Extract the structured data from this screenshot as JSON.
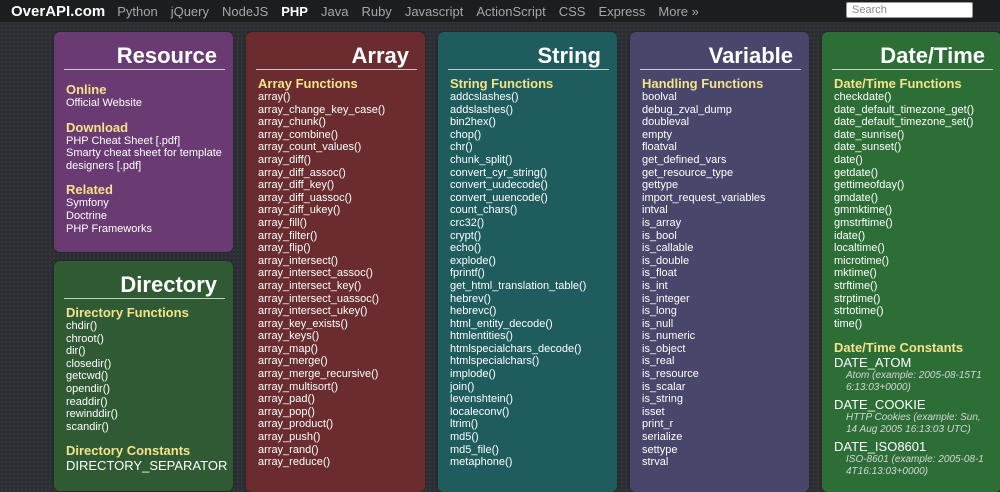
{
  "topbar": {
    "logo": "OverAPI.com",
    "nav": [
      "Python",
      "jQuery",
      "NodeJS",
      "PHP",
      "Java",
      "Ruby",
      "Javascript",
      "ActionScript",
      "CSS",
      "Express",
      "More »"
    ],
    "active": "PHP",
    "search_placeholder": "Search"
  },
  "colors": {
    "resource": "#6a3a73",
    "array": "#6a2c2e",
    "string": "#1f5c5e",
    "variable": "#48466a",
    "datetime": "#2d6e37",
    "directory": "#2f5a34",
    "section_heading": "#f4e38a"
  },
  "resource": {
    "title": "Resource",
    "sections": [
      {
        "heading": "Online",
        "items": [
          "Official Website"
        ]
      },
      {
        "heading": "Download",
        "items": [
          "PHP Cheat Sheet [.pdf]",
          "Smarty cheat sheet for template",
          "designers [.pdf]"
        ]
      },
      {
        "heading": "Related",
        "items": [
          "Symfony",
          "Doctrine",
          "PHP Frameworks"
        ]
      }
    ]
  },
  "directory": {
    "title": "Directory",
    "sections": [
      {
        "heading": "Directory Functions",
        "items": [
          "chdir()",
          "chroot()",
          "dir()",
          "closedir()",
          "getcwd()",
          "opendir()",
          "readdir()",
          "rewinddir()",
          "scandir()"
        ]
      },
      {
        "heading": "Directory Constants",
        "constants": [
          "DIRECTORY_SEPARATOR"
        ]
      }
    ]
  },
  "array": {
    "title": "Array",
    "heading": "Array Functions",
    "items": [
      "array()",
      "array_change_key_case()",
      "array_chunk()",
      "array_combine()",
      "array_count_values()",
      "array_diff()",
      "array_diff_assoc()",
      "array_diff_key()",
      "array_diff_uassoc()",
      "array_diff_ukey()",
      "array_fill()",
      "array_filter()",
      "array_flip()",
      "array_intersect()",
      "array_intersect_assoc()",
      "array_intersect_key()",
      "array_intersect_uassoc()",
      "array_intersect_ukey()",
      "array_key_exists()",
      "array_keys()",
      "array_map()",
      "array_merge()",
      "array_merge_recursive()",
      "array_multisort()",
      "array_pad()",
      "array_pop()",
      "array_product()",
      "array_push()",
      "array_rand()",
      "array_reduce()"
    ]
  },
  "string": {
    "title": "String",
    "heading": "String Functions",
    "items": [
      "addcslashes()",
      "addslashes()",
      "bin2hex()",
      "chop()",
      "chr()",
      "chunk_split()",
      "convert_cyr_string()",
      "convert_uudecode()",
      "convert_uuencode()",
      "count_chars()",
      "crc32()",
      "crypt()",
      "echo()",
      "explode()",
      "fprintf()",
      "get_html_translation_table()",
      "hebrev()",
      "hebrevc()",
      "html_entity_decode()",
      "htmlentities()",
      "htmlspecialchars_decode()",
      "htmlspecialchars()",
      "implode()",
      "join()",
      "levenshtein()",
      "localeconv()",
      "ltrim()",
      "md5()",
      "md5_file()",
      "metaphone()"
    ]
  },
  "variable": {
    "title": "Variable",
    "heading": "Handling Functions",
    "items": [
      "boolval",
      "debug_zval_dump",
      "doubleval",
      "empty",
      "floatval",
      "get_defined_vars",
      "get_resource_type",
      "gettype",
      "import_request_variables",
      "intval",
      "is_array",
      "is_bool",
      "is_callable",
      "is_double",
      "is_float",
      "is_int",
      "is_integer",
      "is_long",
      "is_null",
      "is_numeric",
      "is_object",
      "is_real",
      "is_resource",
      "is_scalar",
      "is_string",
      "isset",
      "print_r",
      "serialize",
      "settype",
      "strval"
    ]
  },
  "datetime": {
    "title": "Date/Time",
    "heading": "Date/Time Functions",
    "items": [
      "checkdate()",
      "date_default_timezone_get()",
      "date_default_timezone_set()",
      "date_sunrise()",
      "date_sunset()",
      "date()",
      "getdate()",
      "gettimeofday()",
      "gmdate()",
      "gmmktime()",
      "gmstrftime()",
      "idate()",
      "localtime()",
      "microtime()",
      "mktime()",
      "strftime()",
      "strptime()",
      "strtotime()",
      "time()"
    ],
    "const_heading": "Date/Time Constants",
    "constants": [
      {
        "name": "DATE_ATOM",
        "desc": [
          "Atom (example: 2005-08-15T1",
          "6:13:03+0000)"
        ]
      },
      {
        "name": "DATE_COOKIE",
        "desc": [
          "HTTP Cookies (example: Sun,",
          "14 Aug 2005 16:13:03 UTC)"
        ]
      },
      {
        "name": "DATE_ISO8601",
        "desc": [
          "ISO-8601 (example: 2005-08-1",
          "4T16:13:03+0000)"
        ]
      }
    ]
  }
}
